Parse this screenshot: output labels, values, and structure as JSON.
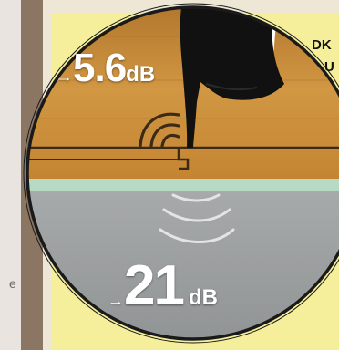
{
  "left_text": "e",
  "impact_sound": {
    "arrow": "→",
    "value": "5.6",
    "unit": "dB"
  },
  "airborne_sound": {
    "arrow": "→",
    "value": "21",
    "unit": "dB"
  },
  "corner_label": {
    "line1": "DK",
    "line2": "U"
  },
  "colors": {
    "wood": "#c98c3b",
    "grey_layer": "#a3a6a7",
    "mint_layer": "#b6dac4",
    "poster": "#f5ef9c",
    "brown_strip": "#8b7664"
  },
  "icons": [
    "high-heel-shoe",
    "sound-waves"
  ]
}
